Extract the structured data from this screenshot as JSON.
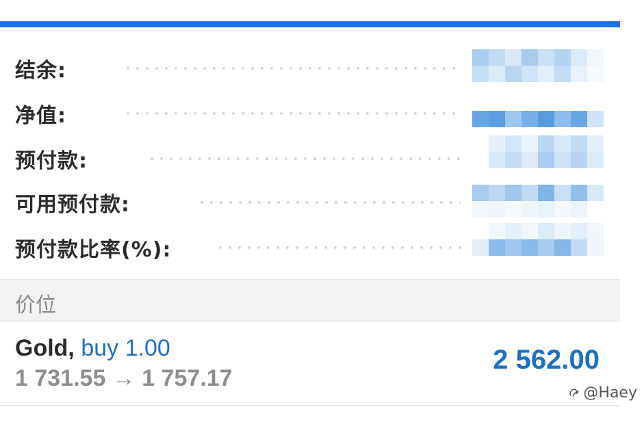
{
  "account": {
    "rows": [
      {
        "label": "结余:"
      },
      {
        "label": "净值:"
      },
      {
        "label": "预付款:"
      },
      {
        "label": "可用预付款:"
      },
      {
        "label": "预付款比率(%):"
      }
    ]
  },
  "section": {
    "header": "价位"
  },
  "position": {
    "symbol": "Gold,",
    "type": "buy 1.00",
    "prices": "1 731.55 → 1 757.17",
    "profit": "2 562.00"
  },
  "watermark": {
    "text": "@Haey",
    "icon": "watermark-logo-icon"
  },
  "colors": {
    "accent": "#1a73e8",
    "profit": "#1e6fc4",
    "label": "#2b2b2b",
    "muted": "#8d8d8d"
  }
}
